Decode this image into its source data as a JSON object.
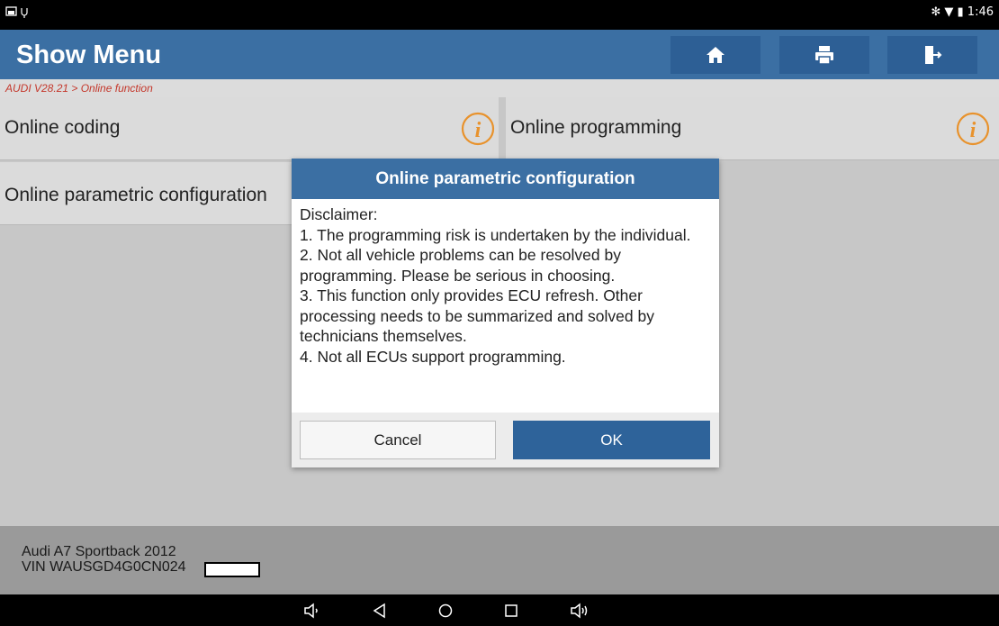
{
  "status_bar": {
    "time": "1:46"
  },
  "header": {
    "title": "Show Menu",
    "buttons": [
      {
        "name": "home-icon"
      },
      {
        "name": "print-icon"
      },
      {
        "name": "exit-icon"
      }
    ]
  },
  "breadcrumb": "AUDI V28.21 > Online function",
  "menu": {
    "items": [
      {
        "label": "Online coding",
        "icon": "info-icon"
      },
      {
        "label": "Online programming",
        "icon": "info-icon"
      },
      {
        "label": "Online parametric configuration"
      }
    ]
  },
  "dialog": {
    "title": "Online parametric configuration",
    "body": "Disclaimer:\n 1. The programming risk is undertaken by the individual.\n 2. Not all vehicle problems can be resolved by programming. Please be serious in choosing.\n 3. This function only provides ECU refresh. Other processing needs to be summarized and solved by technicians themselves.\n 4. Not all ECUs support programming.",
    "cancel_label": "Cancel",
    "ok_label": "OK"
  },
  "footer": {
    "vehicle": "Audi A7 Sportback 2012",
    "vin": "VIN WAUSGD4G0CN024"
  },
  "colors": {
    "accent": "#3b6fa3",
    "button_dark": "#2d5f95",
    "breadcrumb_text": "#c4372b",
    "info_icon": "#e8922c"
  }
}
